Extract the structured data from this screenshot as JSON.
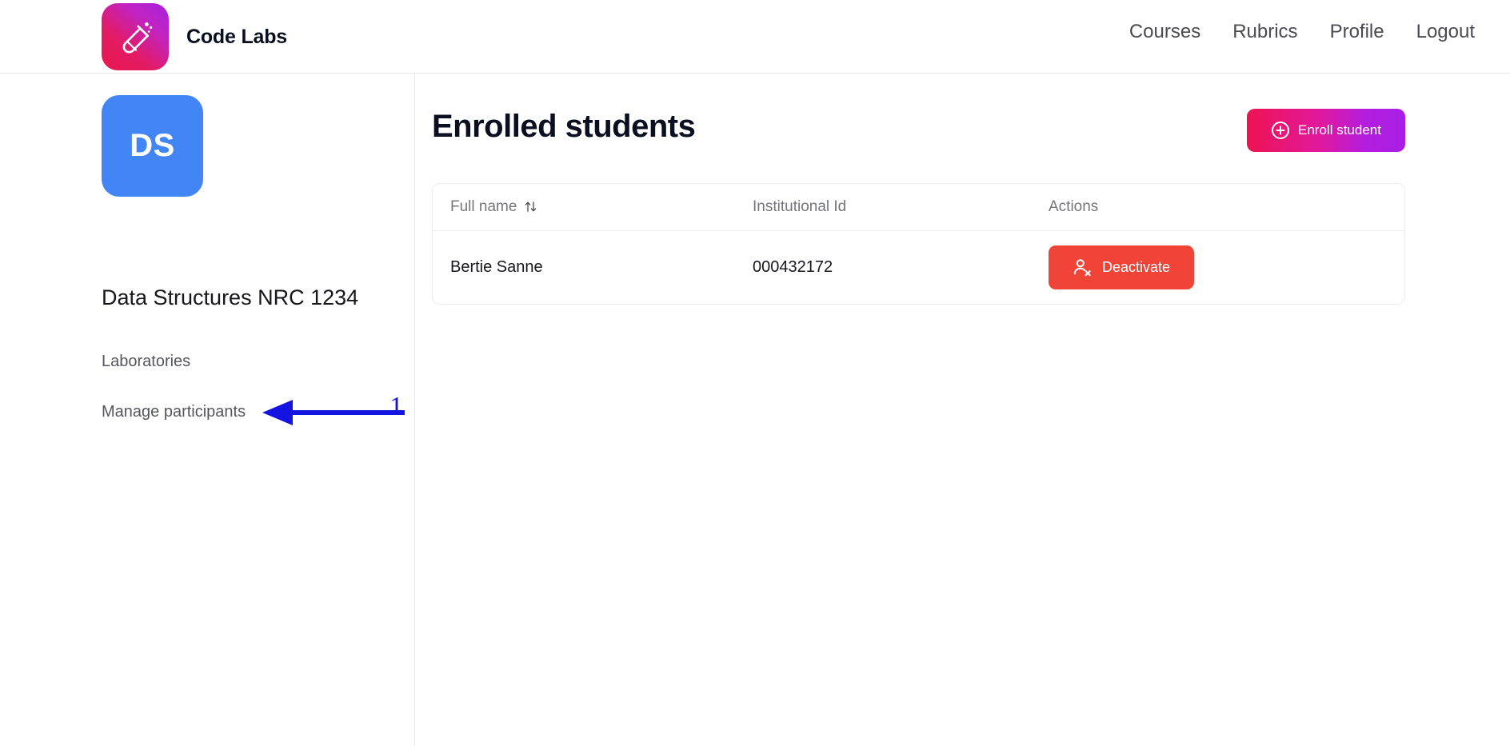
{
  "header": {
    "brand_name": "Code Labs",
    "logo_icon": "test-tube-icon",
    "nav": [
      {
        "label": "Courses"
      },
      {
        "label": "Rubrics"
      },
      {
        "label": "Profile"
      },
      {
        "label": "Logout"
      }
    ]
  },
  "sidebar": {
    "course_initials": "DS",
    "course_title": "Data Structures NRC 1234",
    "links": [
      {
        "label": "Laboratories"
      },
      {
        "label": "Manage participants"
      }
    ]
  },
  "annotation": {
    "number": "1",
    "color": "#1414e0",
    "points_to": "Manage participants"
  },
  "main": {
    "title": "Enrolled students",
    "enroll_button": {
      "label": "Enroll student",
      "icon": "plus-circle-icon"
    },
    "table": {
      "columns": [
        {
          "label": "Full name",
          "sortable": true,
          "sort_icon": "sort-updown-icon"
        },
        {
          "label": "Institutional Id",
          "sortable": false
        },
        {
          "label": "Actions",
          "sortable": false
        }
      ],
      "rows": [
        {
          "full_name": "Bertie Sanne",
          "institutional_id": "000432172",
          "action": {
            "label": "Deactivate",
            "icon": "user-remove-icon"
          }
        }
      ]
    }
  },
  "colors": {
    "brand_gradient_start": "#e8174f",
    "brand_gradient_end": "#a722e0",
    "avatar_blue": "#4285f4",
    "danger_red": "#f04438",
    "annotation_blue": "#1414e0",
    "text_dark": "#16161c",
    "text_muted": "#75757f"
  }
}
